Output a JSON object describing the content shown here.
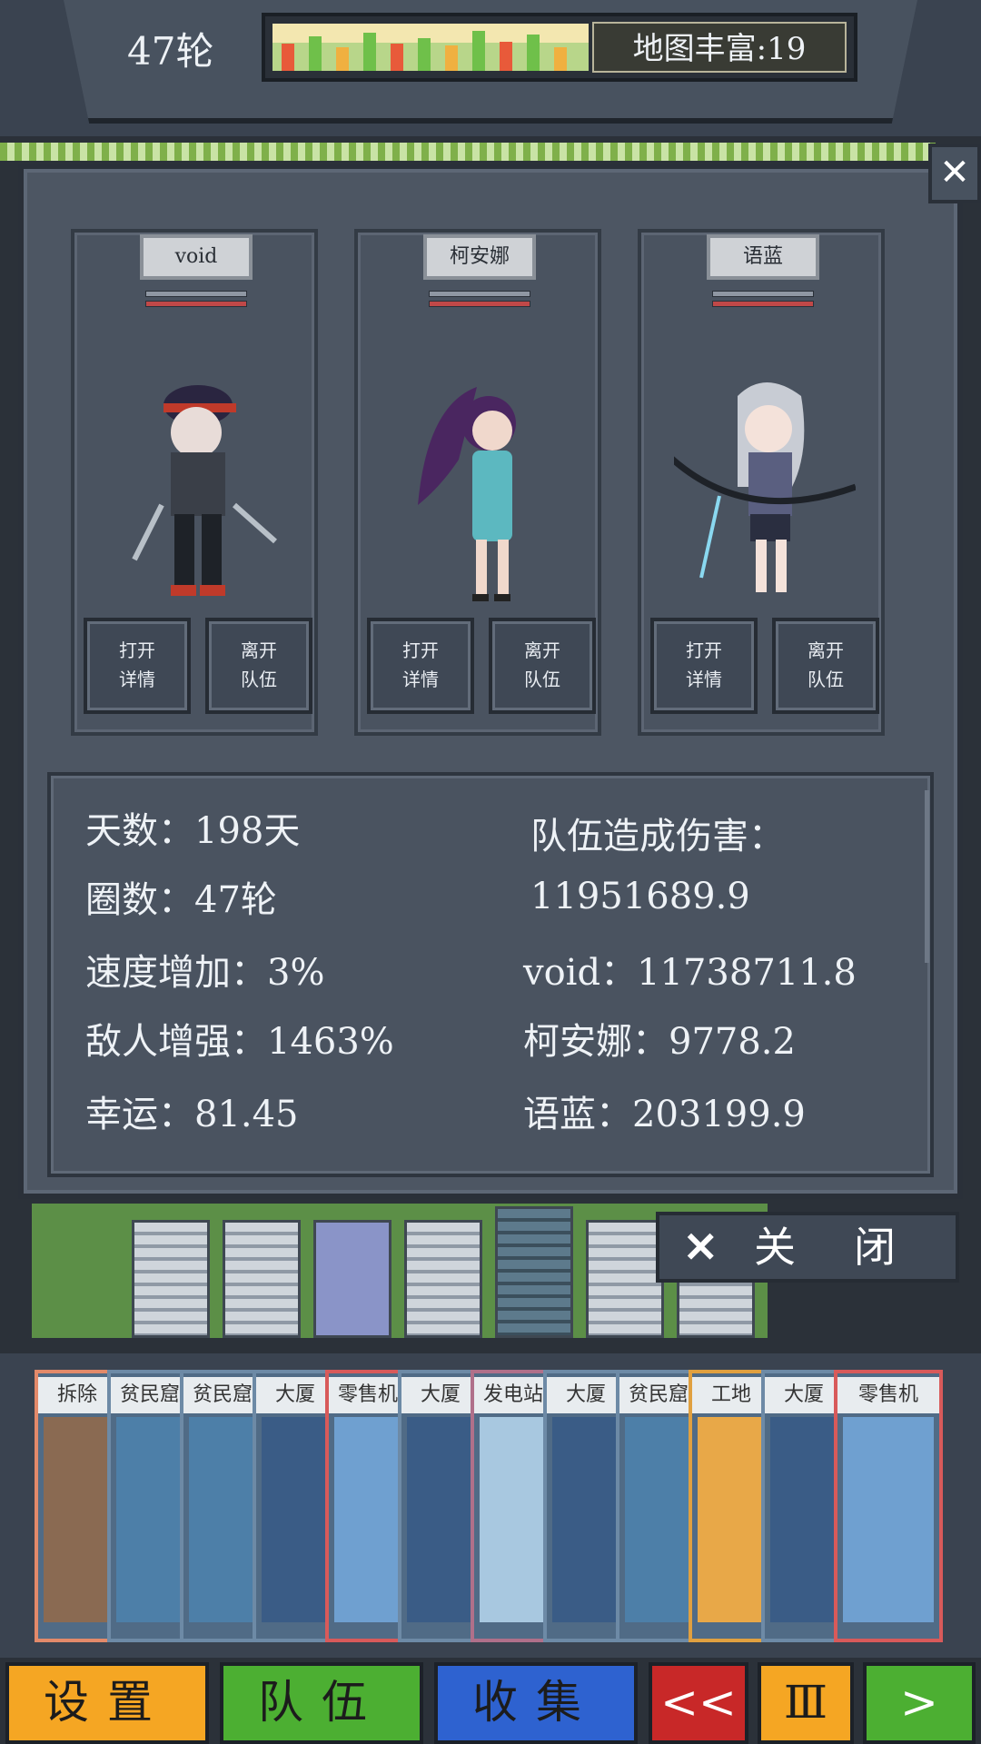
{
  "top_bar": {
    "round_label": "47轮",
    "richness_label": "地图丰富:19",
    "richness_progress": 0.55
  },
  "party": [
    {
      "name": "void",
      "open_details": [
        "打开",
        "详情"
      ],
      "leave_team": [
        "离开",
        "队伍"
      ]
    },
    {
      "name": "柯安娜",
      "open_details": [
        "打开",
        "详情"
      ],
      "leave_team": [
        "离开",
        "队伍"
      ]
    },
    {
      "name": "语蓝",
      "open_details": [
        "打开",
        "详情"
      ],
      "leave_team": [
        "离开",
        "队伍"
      ]
    }
  ],
  "stats": {
    "days": "天数：198天",
    "laps": "圈数：47轮",
    "speed": "速度增加：3%",
    "enemy": "敌人增强：1463%",
    "luck": "幸运：81.45",
    "damage_title": "队伍造成伤害：",
    "damage_total": "11951689.9",
    "damage_void": "void：11738711.8",
    "damage_keanna": "柯安娜：9778.2",
    "damage_yulan": "语蓝：203199.9"
  },
  "close_button": {
    "icon": "close-x-icon",
    "label": "关闭"
  },
  "hand_cards": [
    {
      "label": "拆除",
      "border": "#e38a6a",
      "art": "#8a6a52"
    },
    {
      "label": "贫民窟",
      "border": "#6d8aa6",
      "art": "#4d7fa8"
    },
    {
      "label": "贫民窟",
      "border": "#6d8aa6",
      "art": "#4d7fa8"
    },
    {
      "label": "大厦",
      "border": "#6d8aa6",
      "art": "#3a5c86"
    },
    {
      "label": "零售机",
      "border": "#d85a5a",
      "art": "#6fa0d0"
    },
    {
      "label": "大厦",
      "border": "#6d8aa6",
      "art": "#3a5c86"
    },
    {
      "label": "发电站",
      "border": "#b0708a",
      "art": "#a8c8e0"
    },
    {
      "label": "大厦",
      "border": "#6d8aa6",
      "art": "#3a5c86"
    },
    {
      "label": "贫民窟",
      "border": "#6d8aa6",
      "art": "#4d7fa8"
    },
    {
      "label": "工地",
      "border": "#e0a040",
      "art": "#e8a848"
    },
    {
      "label": "大厦",
      "border": "#6d8aa6",
      "art": "#3a5c86"
    },
    {
      "label": "零售机",
      "border": "#d85a5a",
      "art": "#6fa0d0"
    }
  ],
  "bottom_buttons": [
    {
      "label": "设置",
      "color": "#f5a623"
    },
    {
      "label": "队伍",
      "color": "#4caf32"
    },
    {
      "label": "收集",
      "color": "#2e62d0"
    },
    {
      "label": "<<",
      "color": "#c82828"
    },
    {
      "label": "Ⅲ",
      "color": "#f5a623"
    },
    {
      "label": ">",
      "color": "#4caf32"
    }
  ]
}
